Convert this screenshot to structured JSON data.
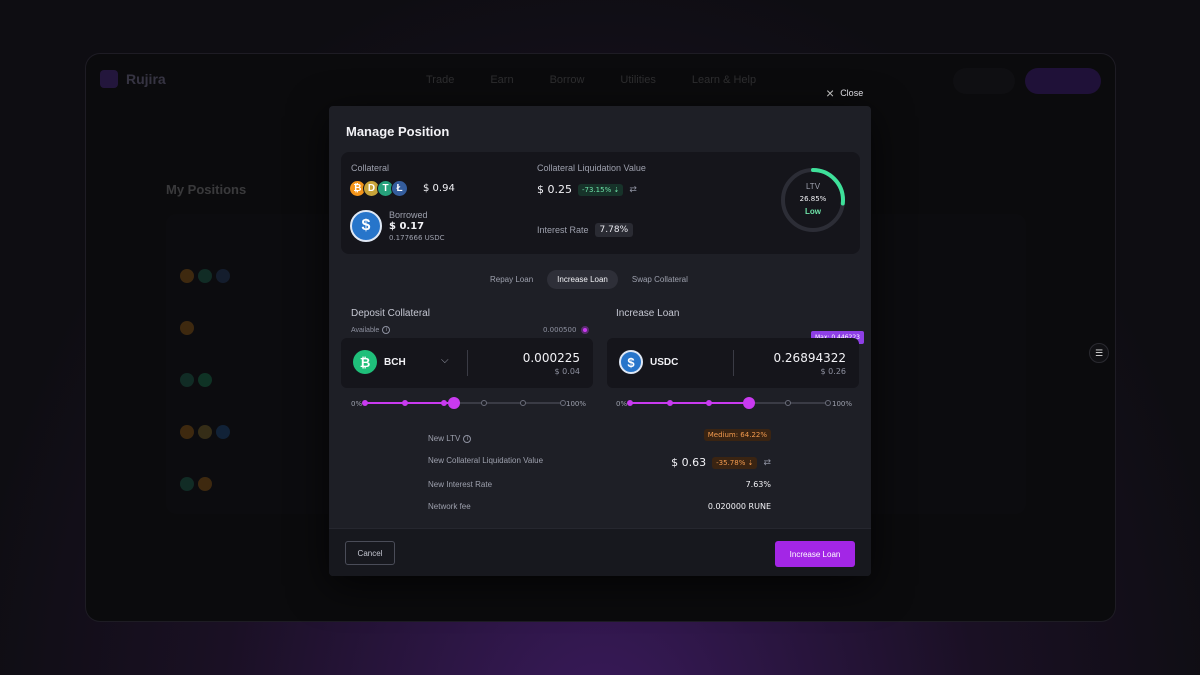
{
  "close": {
    "label": "Close"
  },
  "modal": {
    "title": "Manage Position",
    "summary": {
      "collateral_label": "Collateral",
      "collateral_value": "$ 0.94",
      "collateral_coins": [
        {
          "icon": "bitcoin-icon",
          "glyph": "₿",
          "color": "#f2941a"
        },
        {
          "icon": "dogecoin-icon",
          "glyph": "D",
          "color": "#c8a43a"
        },
        {
          "icon": "tether-icon",
          "glyph": "T",
          "color": "#26a17b"
        },
        {
          "icon": "litecoin-icon",
          "glyph": "Ł",
          "color": "#345d9d"
        }
      ],
      "borrowed_label": "Borrowed",
      "borrowed_value": "$ 0.17",
      "borrowed_amount": "0.177666 USDC",
      "liq_label": "Collateral Liquidation Value",
      "liq_value": "$ 0.25",
      "liq_change": "-73.15% ⇣",
      "interest_label": "Interest Rate",
      "interest_value": "7.78%",
      "ltv": {
        "label": "LTV",
        "value": "26.85%",
        "status": "Low",
        "fraction": 0.2685,
        "color": "#3ee09a"
      }
    },
    "tabs": [
      {
        "label": "Repay Loan",
        "active": false
      },
      {
        "label": "Increase Loan",
        "active": true
      },
      {
        "label": "Swap Collateral",
        "active": false
      }
    ],
    "deposit": {
      "title": "Deposit Collateral",
      "available_label": "Available",
      "available_value": "0.000500",
      "asset": "BCH",
      "asset_color": "#1fbf7a",
      "amount": "0.000225",
      "amount_usd": "$ 0.04",
      "slider_fraction": 0.45,
      "min_label": "0%",
      "max_label": "100%"
    },
    "increase": {
      "title": "Increase Loan",
      "max_tag": "Max: 0.446223",
      "asset": "USDC",
      "asset_color": "#2775ca",
      "amount": "0.26894322",
      "amount_usd": "$ 0.26",
      "slider_fraction": 0.6,
      "min_label": "0%",
      "max_label": "100%"
    },
    "details": [
      {
        "label": "New LTV",
        "value": "Medium: 64.22%",
        "kind": "badge"
      },
      {
        "label": "New Collateral Liquidation Value",
        "value": "$ 0.63",
        "change": "-35.78% ⇣",
        "kind": "liq"
      },
      {
        "label": "New Interest Rate",
        "value": "7.63%",
        "kind": "text"
      },
      {
        "label": "Network fee",
        "value": "0.020000 RUNE",
        "kind": "text"
      }
    ],
    "cancel_label": "Cancel",
    "primary_label": "Increase Loan"
  },
  "background": {
    "brand": "Rujira",
    "nav": [
      "Trade",
      "Earn",
      "Borrow",
      "Utilities",
      "Learn & Help"
    ],
    "page_title": "My Positions"
  }
}
